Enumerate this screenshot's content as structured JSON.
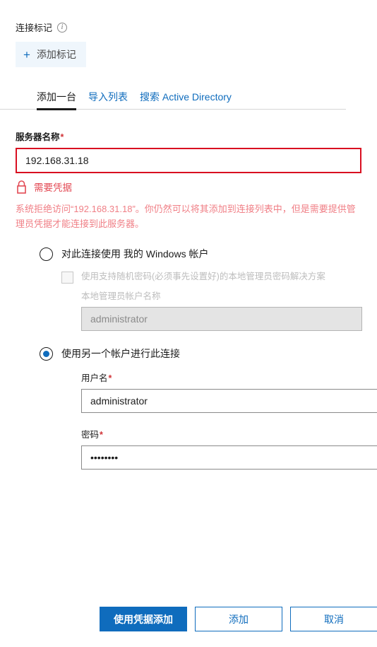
{
  "tags": {
    "header_label": "连接标记",
    "info_icon": "info-circle-icon",
    "add_tag_label": "添加标记",
    "plus_glyph": "+"
  },
  "tabs": [
    {
      "label": "添加一台",
      "active": true
    },
    {
      "label": "导入列表",
      "active": false
    },
    {
      "label": "搜索 Active Directory",
      "active": false
    }
  ],
  "server": {
    "label": "服务器名称",
    "required_marker": "*",
    "value": "192.168.31.18",
    "credential_warning": "需要凭据",
    "lock_icon": "lock-icon",
    "error_message": "系统拒绝访问“192.168.31.18”。你仍然可以将其添加到连接列表中，但是需要提供管理员凭据才能连接到此服务器。"
  },
  "options": {
    "windows_account": {
      "label": "对此连接使用 我的 Windows 帐户",
      "selected": false,
      "laps_checkbox_label": "使用支持随机密码(必须事先设置好)的本地管理员密码解决方案",
      "laps_checked": false,
      "local_admin_label": "本地管理员帐户名称",
      "local_admin_placeholder": "administrator",
      "local_admin_value": ""
    },
    "other_account": {
      "label": "使用另一个帐户进行此连接",
      "selected": true,
      "username_label": "用户名",
      "username_required": "*",
      "username_value": "administrator",
      "password_label": "密码",
      "password_required": "*",
      "password_value": "••••••••"
    }
  },
  "footer": {
    "add_with_credentials": "使用凭据添加",
    "add": "添加",
    "cancel": "取消"
  },
  "colors": {
    "accent": "#0f6cbd",
    "error_border": "#d90f21",
    "error_text": "#f07f86",
    "warning_text": "#e34a54",
    "required": "#d13438",
    "tag_bg": "#eff6fc"
  }
}
